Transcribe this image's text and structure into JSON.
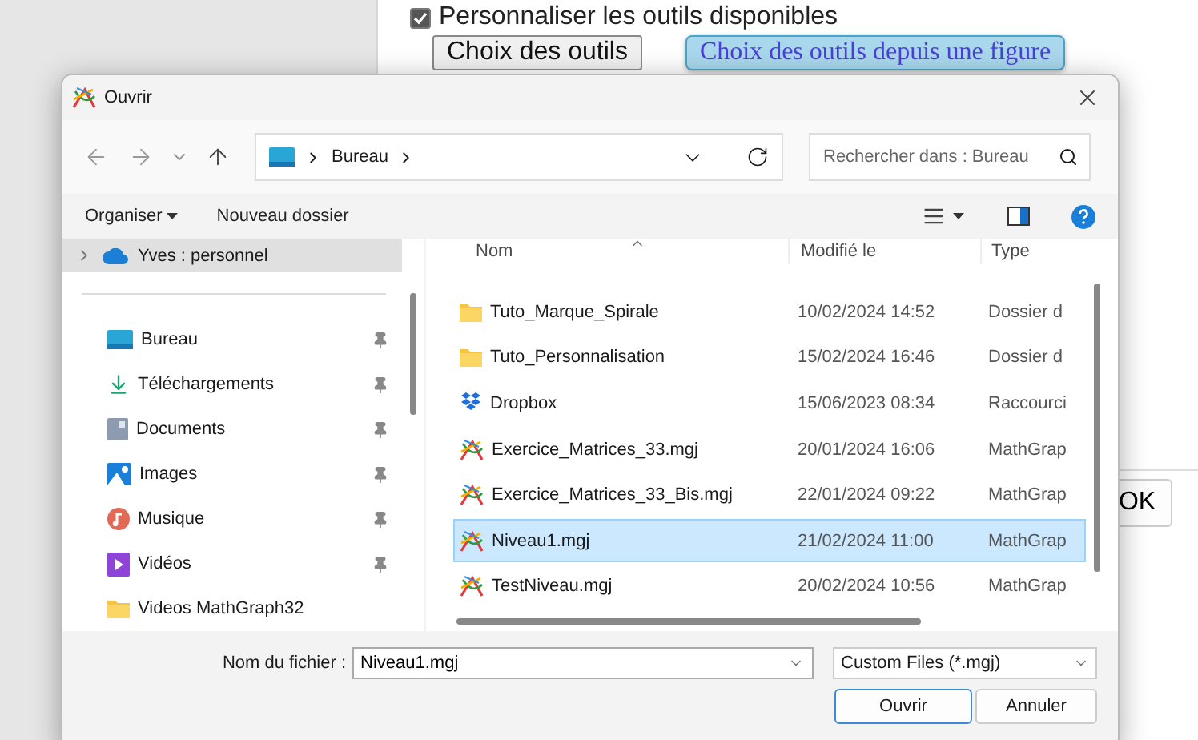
{
  "page": {
    "option": {
      "label": "Personnaliser les outils disponibles",
      "checked": true
    },
    "buttons": [
      {
        "label": "Choix des outils",
        "kind": "plain"
      },
      {
        "label": "Choix des outils depuis une figure",
        "kind": "highlight"
      }
    ],
    "ok_button": "OK"
  },
  "dialog": {
    "title": "Ouvrir",
    "address": {
      "crumbs": [
        "Bureau"
      ]
    },
    "search": {
      "placeholder": "Rechercher dans : Bureau"
    },
    "toolbar": {
      "organize": "Organiser",
      "new_folder": "Nouveau dossier"
    },
    "sidebar": {
      "account": {
        "label": "Yves : personnel",
        "selected": true
      },
      "items": [
        {
          "label": "Bureau",
          "kind": "desktop",
          "pinned": true
        },
        {
          "label": "Téléchargements",
          "kind": "download",
          "pinned": true
        },
        {
          "label": "Documents",
          "kind": "documents",
          "pinned": true
        },
        {
          "label": "Images",
          "kind": "images",
          "pinned": true
        },
        {
          "label": "Musique",
          "kind": "music",
          "pinned": true
        },
        {
          "label": "Vidéos",
          "kind": "videos",
          "pinned": true
        },
        {
          "label": "Videos MathGraph32",
          "kind": "folder",
          "pinned": false
        }
      ]
    },
    "columns": [
      "Nom",
      "Modifié le",
      "Type"
    ],
    "rows": [
      {
        "name": "Tuto_Marque_Spirale",
        "modified": "10/02/2024 14:52",
        "type": "Dossier d",
        "kind": "folder",
        "selected": false
      },
      {
        "name": "Tuto_Personnalisation",
        "modified": "15/02/2024 16:46",
        "type": "Dossier d",
        "kind": "folder",
        "selected": false
      },
      {
        "name": "Dropbox",
        "modified": "15/06/2023 08:34",
        "type": "Raccourci",
        "kind": "shortcut",
        "selected": false
      },
      {
        "name": "Exercice_Matrices_33.mgj",
        "modified": "20/01/2024 16:06",
        "type": "MathGrap",
        "kind": "mgj",
        "selected": false
      },
      {
        "name": "Exercice_Matrices_33_Bis.mgj",
        "modified": "22/01/2024 09:22",
        "type": "MathGrap",
        "kind": "mgj",
        "selected": false
      },
      {
        "name": "Niveau1.mgj",
        "modified": "21/02/2024 11:00",
        "type": "MathGrap",
        "kind": "mgj",
        "selected": true
      },
      {
        "name": "TestNiveau.mgj",
        "modified": "20/02/2024 10:56",
        "type": "MathGrap",
        "kind": "mgj",
        "selected": false
      }
    ],
    "filename": {
      "label": "Nom du fichier :",
      "value": "Niveau1.mgj"
    },
    "filter": "Custom Files (*.mgj)",
    "buttons": [
      {
        "label": "Ouvrir",
        "kind": "primary"
      },
      {
        "label": "Annuler",
        "kind": "secondary"
      }
    ]
  }
}
